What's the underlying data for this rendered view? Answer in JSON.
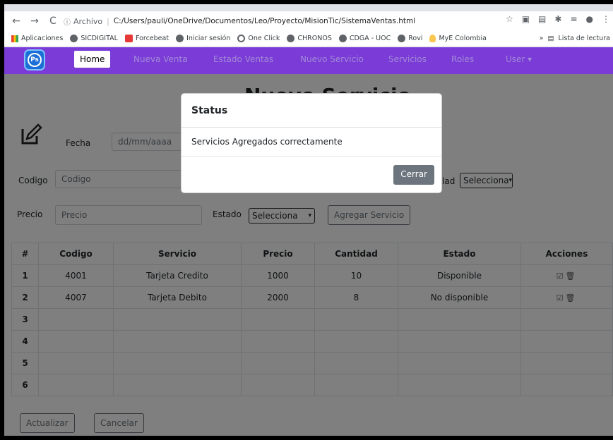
{
  "browser": {
    "archivo_label": "Archivo",
    "url": "C:/Users/pauli/OneDrive/Documentos/Leo/Proyecto/MisionTic/SistemaVentas.html",
    "bookmarks": [
      "Aplicaciones",
      "SICDIGITAL",
      "Forcebeat",
      "Iniciar sesión",
      "One Click",
      "CHRONOS",
      "CDGA - UOC",
      "Rovi",
      "MyE Colombia"
    ],
    "reading_list": "Lista de lectura"
  },
  "navbar": {
    "logo": "Ps",
    "links": [
      "Home",
      "Nueva Venta",
      "Estado Ventas",
      "Nuevo Servicio",
      "Servicios",
      "Roles",
      "User ▾"
    ]
  },
  "form": {
    "title": "Nuevo Servicio",
    "fecha_label": "Fecha",
    "fecha_placeholder": "dd/mm/aaaa",
    "codigo_label": "Codigo",
    "codigo_placeholder": "Codigo",
    "disponibilidad_label": "lad",
    "disponibilidad_select": "Selecciona",
    "precio_label": "Precio",
    "precio_placeholder": "Precio",
    "estado_label": "Estado",
    "estado_select": "Selecciona",
    "agregar_button": "Agregar Servicio"
  },
  "table": {
    "headers": [
      "#",
      "Codigo",
      "Servicio",
      "Precio",
      "Cantidad",
      "Estado",
      "Acciones"
    ],
    "rows": [
      {
        "n": "1",
        "codigo": "4001",
        "servicio": "Tarjeta Credito",
        "precio": "1000",
        "cantidad": "10",
        "estado": "Disponible"
      },
      {
        "n": "2",
        "codigo": "4007",
        "servicio": "Tarjeta Debito",
        "precio": "2000",
        "cantidad": "8",
        "estado": "No disponible"
      },
      {
        "n": "3",
        "codigo": "",
        "servicio": "",
        "precio": "",
        "cantidad": "",
        "estado": ""
      },
      {
        "n": "4",
        "codigo": "",
        "servicio": "",
        "precio": "",
        "cantidad": "",
        "estado": ""
      },
      {
        "n": "5",
        "codigo": "",
        "servicio": "",
        "precio": "",
        "cantidad": "",
        "estado": ""
      },
      {
        "n": "6",
        "codigo": "",
        "servicio": "",
        "precio": "",
        "cantidad": "",
        "estado": ""
      }
    ]
  },
  "footer": {
    "actualizar": "Actualizar",
    "cancelar": "Cancelar"
  },
  "modal": {
    "title": "Status",
    "message": "Servicios Agregados correctamente",
    "close": "Cerrar"
  }
}
